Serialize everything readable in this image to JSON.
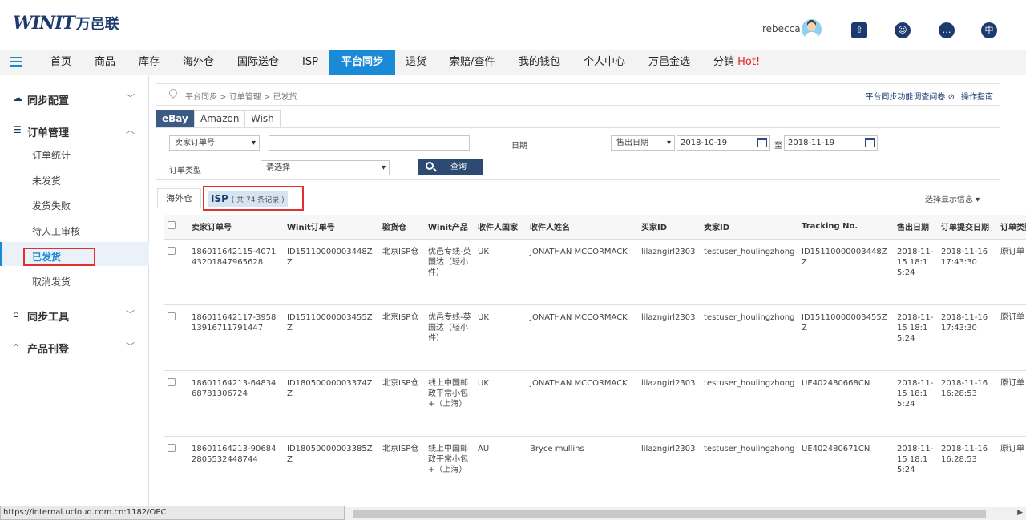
{
  "header": {
    "logo_mark": "WINIT",
    "logo_cn": "万邑联",
    "username": "rebecca",
    "icons": [
      "upload-icon",
      "user-support-icon",
      "chat-icon",
      "language-icon"
    ]
  },
  "nav": {
    "items": [
      "首页",
      "商品",
      "库存",
      "海外仓",
      "国际送仓",
      "ISP",
      "平台同步",
      "退货",
      "索赔/查件",
      "我的钱包",
      "个人中心",
      "万邑金选",
      "分销"
    ],
    "active": "平台同步",
    "hot": "Hot!"
  },
  "sidebar": {
    "groups": [
      {
        "label": "同步配置"
      },
      {
        "label": "订单管理"
      },
      {
        "label": "同步工具"
      },
      {
        "label": "产品刊登"
      }
    ],
    "order_items": [
      "订单统计",
      "未发货",
      "发货失败",
      "待人工审核",
      "已发货",
      "取消发货"
    ],
    "active_item": "已发货"
  },
  "breadcrumb": {
    "text": "平台同步 > 订单管理 > 已发货",
    "survey": "平台同步功能调查问卷",
    "guide": "操作指南"
  },
  "platform_tabs": [
    "eBay",
    "Amazon",
    "Wish"
  ],
  "filters": {
    "order_no_select": "卖家订单号",
    "order_no_value": "",
    "date_label": "日期",
    "date_type": "售出日期",
    "date_from": "2018-10-19",
    "to_label": "至",
    "date_to": "2018-11-19",
    "order_type_label": "订单类型",
    "order_type_select": "请选择",
    "search_button": "查询"
  },
  "warehouse_tabs": {
    "overseas": "海外仓",
    "isp": "ISP",
    "isp_count": "( 共 74 条记录 )",
    "choose_columns": "选择显示信息"
  },
  "table": {
    "headers": [
      "卖家订单号",
      "Winit订单号",
      "验货仓",
      "Winit产品",
      "收件人国家",
      "收件人姓名",
      "买家ID",
      "卖家ID",
      "Tracking No.",
      "售出日期",
      "订单提交日期",
      "订单类型"
    ],
    "rows": [
      {
        "seller_order": "186011642115-407143201847965628",
        "winit_order": "ID15110000003448ZZ",
        "warehouse": "北京ISP仓",
        "product": "优邑专线-英国达（轻小件）",
        "country": "UK",
        "recipient": "JONATHAN MCCORMACK",
        "buyer_id": "lilazngirl2303",
        "seller_id": "testuser_houlingzhong",
        "tracking": "ID15110000003448ZZ",
        "sold_date": "2018-11-15 18:15:24",
        "submit_date": "2018-11-16 17:43:30",
        "order_type": "原订单"
      },
      {
        "seller_order": "186011642117-395813916711791447",
        "winit_order": "ID15110000003455ZZ",
        "warehouse": "北京ISP仓",
        "product": "优邑专线-英国达（轻小件）",
        "country": "UK",
        "recipient": "JONATHAN MCCORMACK",
        "buyer_id": "lilazngirl2303",
        "seller_id": "testuser_houlingzhong",
        "tracking": "ID15110000003455ZZ",
        "sold_date": "2018-11-15 18:15:24",
        "submit_date": "2018-11-16 17:43:30",
        "order_type": "原订单"
      },
      {
        "seller_order": "18601164213-6483468781306724",
        "winit_order": "ID18050000003374ZZ",
        "warehouse": "北京ISP仓",
        "product": "线上中国邮政平常小包+（上海）",
        "country": "UK",
        "recipient": "JONATHAN MCCORMACK",
        "buyer_id": "lilazngirl2303",
        "seller_id": "testuser_houlingzhong",
        "tracking": "UE402480668CN",
        "sold_date": "2018-11-15 18:15:24",
        "submit_date": "2018-11-16 16:28:53",
        "order_type": "原订单"
      },
      {
        "seller_order": "18601164213-906842805532448744",
        "winit_order": "ID18050000003385ZZ",
        "warehouse": "北京ISP仓",
        "product": "线上中国邮政平常小包+（上海）",
        "country": "AU",
        "recipient": "Bryce mullins",
        "buyer_id": "lilazngirl2303",
        "seller_id": "testuser_houlingzhong",
        "tracking": "UE402480671CN",
        "sold_date": "2018-11-15 18:15:24",
        "submit_date": "2018-11-16 16:28:53",
        "order_type": "原订单"
      }
    ]
  },
  "status_url": "https://internal.ucloud.com.cn:1182/OPC"
}
